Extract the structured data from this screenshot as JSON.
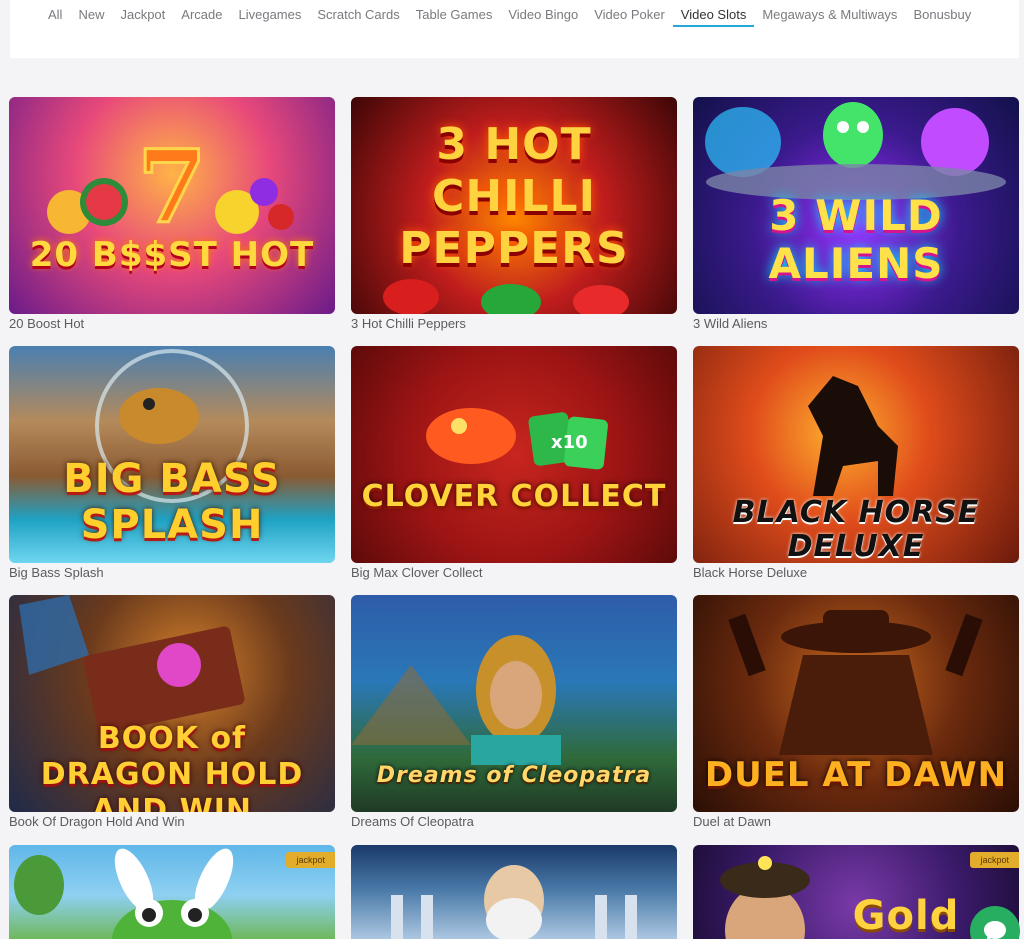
{
  "tabs": [
    {
      "label": "All"
    },
    {
      "label": "New"
    },
    {
      "label": "Jackpot"
    },
    {
      "label": "Arcade"
    },
    {
      "label": "Livegames"
    },
    {
      "label": "Scratch Cards"
    },
    {
      "label": "Table Games"
    },
    {
      "label": "Video Bingo"
    },
    {
      "label": "Video Poker"
    },
    {
      "label": "Video Slots",
      "active": true
    },
    {
      "label": "Megaways & Multiways"
    },
    {
      "label": "Bonusbuy"
    }
  ],
  "games": [
    {
      "title": "20 Boost Hot",
      "art": "20 B$$ST HOT"
    },
    {
      "title": "3 Hot Chilli Peppers",
      "art": "3 HOT CHILLI PEPPERS"
    },
    {
      "title": "3 Wild Aliens",
      "art": "3 WILD ALIENS"
    },
    {
      "title": "Big Bass Splash",
      "art": "BIG BASS SPLASH"
    },
    {
      "title": "Big Max Clover Collect",
      "art": "CLOVER COLLECT"
    },
    {
      "title": "Black Horse Deluxe",
      "art": "BLACK HORSE DELUXE"
    },
    {
      "title": "Book Of Dragon Hold And Win",
      "art": "BOOK of DRAGON HOLD AND WIN"
    },
    {
      "title": "Dreams Of Cleopatra",
      "art": "Dreams of Cleopatra"
    },
    {
      "title": "Duel at Dawn",
      "art": "DUEL AT DAWN"
    }
  ],
  "partial_games": [
    {
      "badge": "jackpot"
    },
    {
      "badge": ""
    },
    {
      "badge": "jackpot",
      "art": "Gold"
    }
  ],
  "colors": {
    "accent": "#27a7d4",
    "badge": "#e3ad2c",
    "chat": "#27ae60"
  },
  "chat_icon": "chat-bubble-icon"
}
